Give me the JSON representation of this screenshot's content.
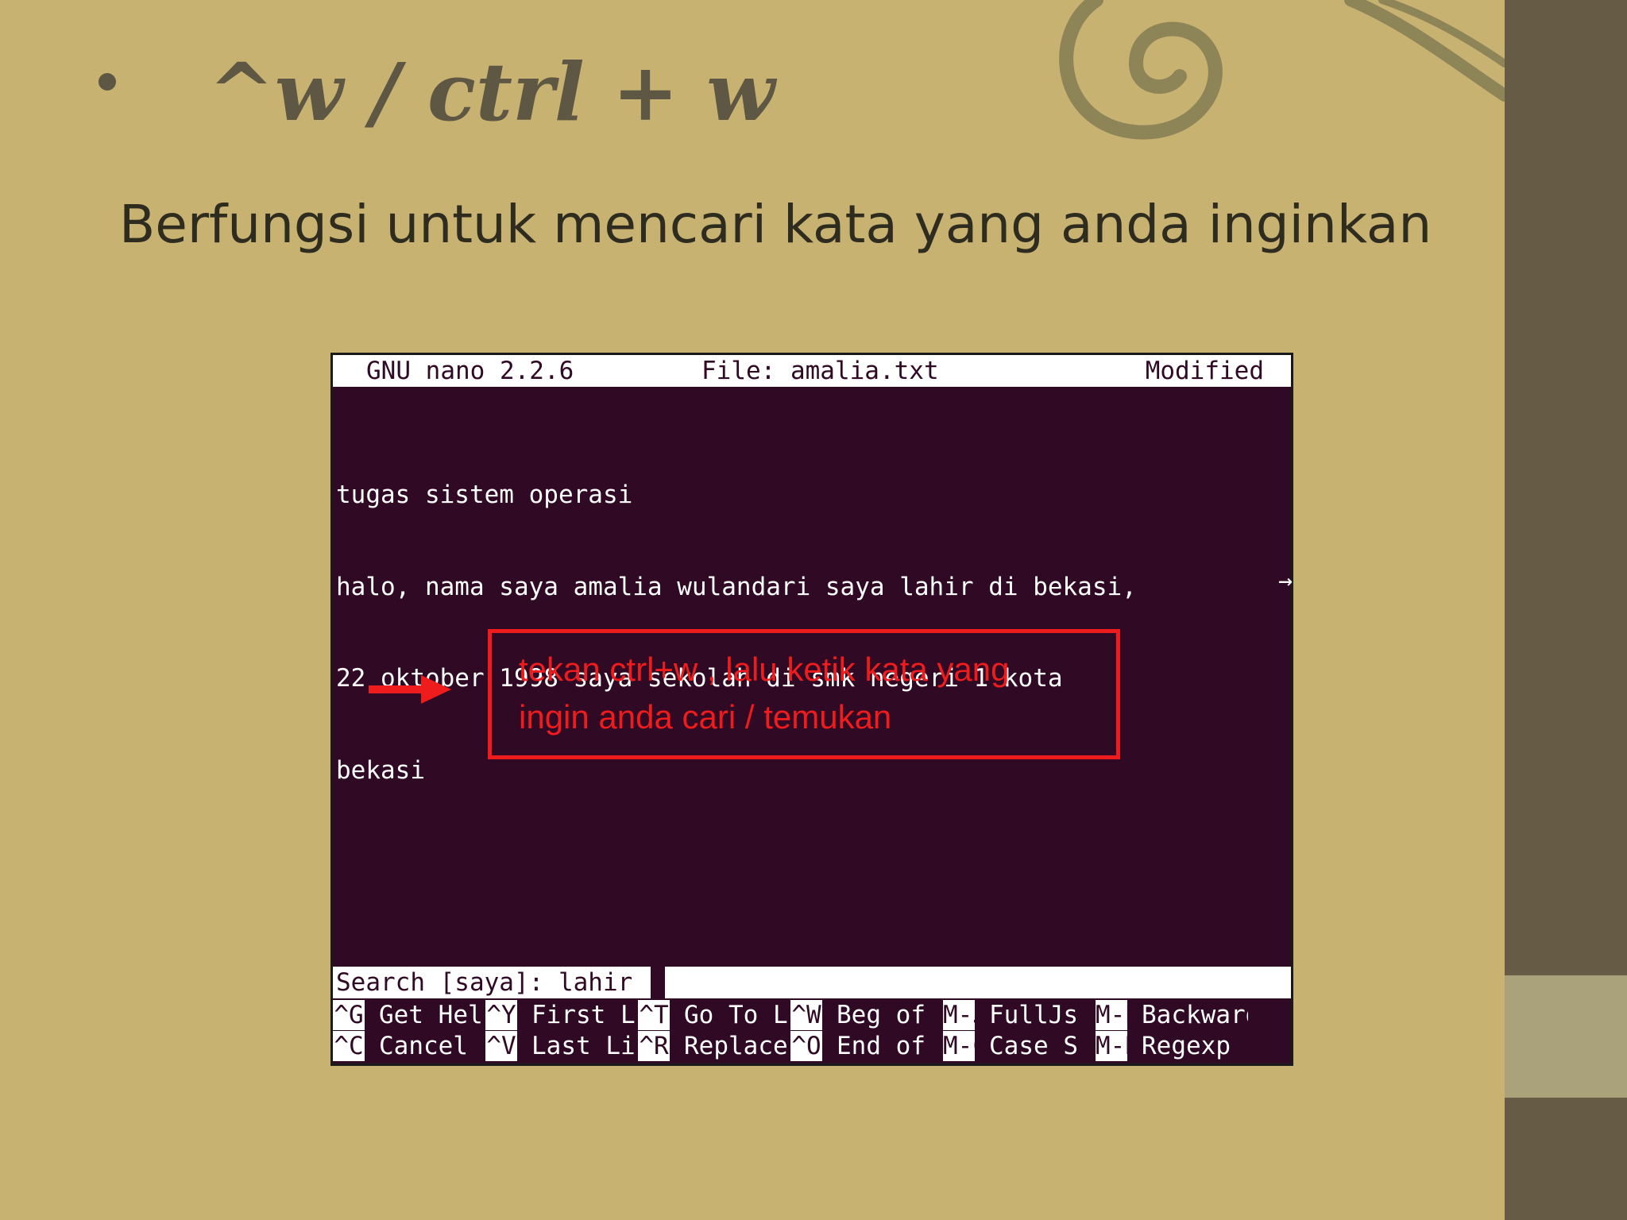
{
  "slide": {
    "bullet_title": "^w / ctrl + w",
    "subtitle": "Berfungsi untuk mencari kata yang anda inginkan"
  },
  "terminal": {
    "header": {
      "app": "GNU nano 2.2.6",
      "file": "File: amalia.txt",
      "status": "Modified"
    },
    "lines": [
      "tugas sistem operasi",
      "halo, nama saya amalia wulandari saya lahir di bekasi,",
      "22 oktober 1998 saya sekolah di smk negeri 1 kota",
      "bekasi"
    ],
    "scroll_marker": "→",
    "search": {
      "text": "Search [saya]: lahir"
    },
    "shortcuts_row1": [
      {
        "key": "^G",
        "label": "Get Hel"
      },
      {
        "key": "^Y",
        "label": "First L"
      },
      {
        "key": "^T",
        "label": "Go To L"
      },
      {
        "key": "^W",
        "label": "Beg of"
      },
      {
        "key": "M-J",
        "label": "FullJs"
      },
      {
        "key": "M-B",
        "label": "Backwards"
      }
    ],
    "shortcuts_row2": [
      {
        "key": "^C",
        "label": "Cancel"
      },
      {
        "key": "^V",
        "label": "Last Li"
      },
      {
        "key": "^R",
        "label": "Replace"
      },
      {
        "key": "^O",
        "label": "End of"
      },
      {
        "key": "M-C",
        "label": "Case S"
      },
      {
        "key": "M-R",
        "label": "Regexp"
      }
    ]
  },
  "annotation": {
    "line1": "tekan ctrl+w , lalu ketik kata yang",
    "line2": "ingin anda cari / temukan",
    "color": "#ee1c1c"
  },
  "colors": {
    "slide_background": "#c8b272",
    "sidebar": "#665c46",
    "terminal_background": "#300a24"
  }
}
